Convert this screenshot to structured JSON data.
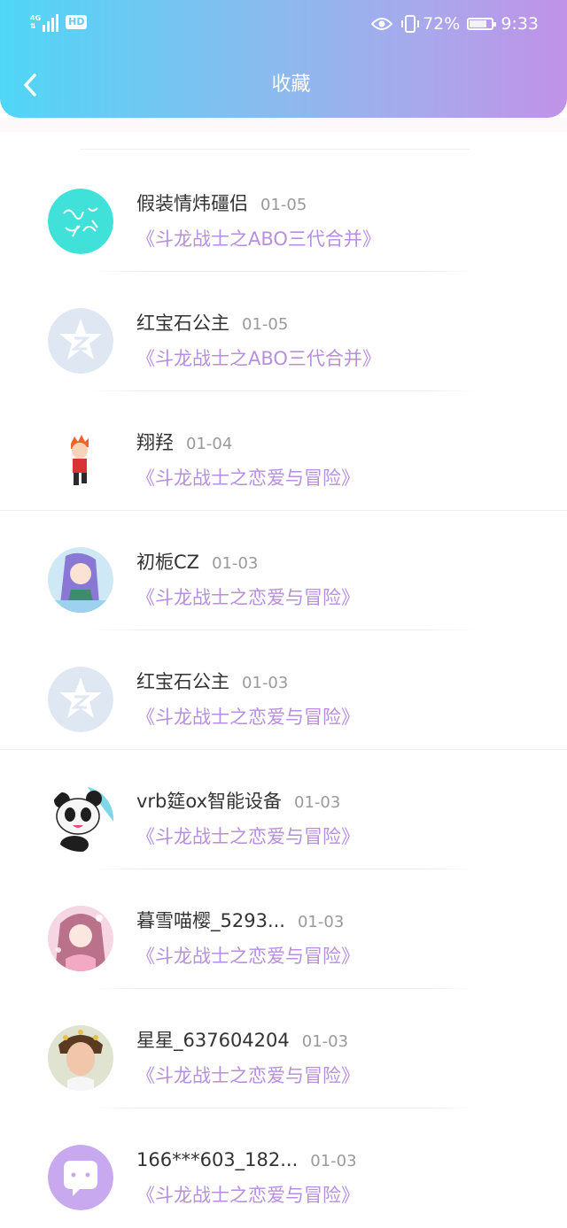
{
  "status_bar": {
    "network": "4G",
    "hd": "HD",
    "battery": "72%",
    "battery_level": 0.72,
    "time": "9:33"
  },
  "header": {
    "title": "收藏",
    "back_icon": "chevron-left-icon",
    "gradient_colors": [
      "#4fd6f6",
      "#c092e8"
    ]
  },
  "favorites": [
    {
      "user": "假装情炜礓侣",
      "date": "01-05",
      "book": "《斗龙战士之ABO三代合并》",
      "avatar": "cyan-handwriting-avatar"
    },
    {
      "user": "红宝石公主",
      "date": "01-05",
      "book": "《斗龙战士之ABO三代合并》",
      "avatar": "default-qq-avatar"
    },
    {
      "user": "翔羟",
      "date": "01-04",
      "book": "《斗龙战士之恋爱与冒险》",
      "avatar": "anime-boy-avatar"
    },
    {
      "user": "初栀CZ",
      "date": "01-03",
      "book": "《斗龙战士之恋爱与冒险》",
      "avatar": "anime-girl-avatar"
    },
    {
      "user": "红宝石公主",
      "date": "01-03",
      "book": "《斗龙战士之恋爱与冒险》",
      "avatar": "default-qq-avatar"
    },
    {
      "user": "vrb筵ox智能设备",
      "date": "01-03",
      "book": "《斗龙战士之恋爱与冒险》",
      "avatar": "panda-avatar"
    },
    {
      "user": "暮雪喵樱_5293...",
      "date": "01-03",
      "book": "《斗龙战士之恋爱与冒险》",
      "avatar": "pink-anime-girl-avatar"
    },
    {
      "user": "星星_637604204",
      "date": "01-03",
      "book": "《斗龙战士之恋爱与冒险》",
      "avatar": "photo-child-avatar"
    },
    {
      "user": "166***603_182...",
      "date": "01-03",
      "book": "《斗龙战士之恋爱与冒险》",
      "avatar": "purple-chat-avatar"
    }
  ],
  "colors": {
    "book_title": "#b78fde",
    "user_name": "#333333",
    "date": "#9a9a9a"
  }
}
